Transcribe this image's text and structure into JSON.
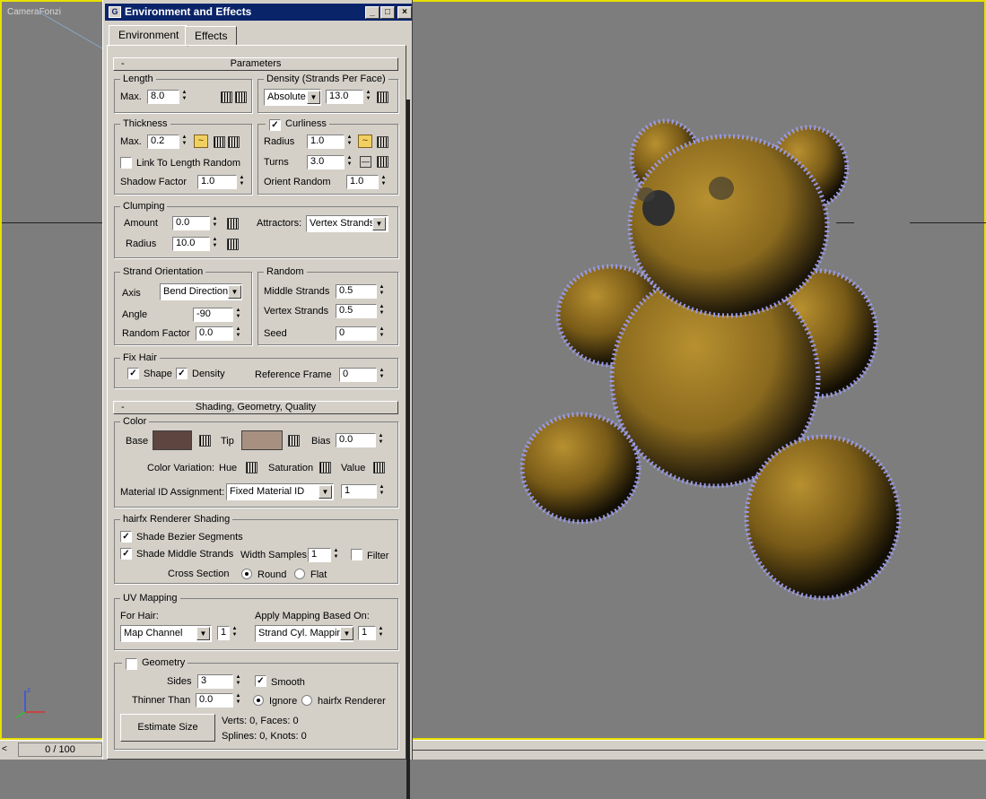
{
  "viewport": {
    "label": "CameraFonzi"
  },
  "timeline": {
    "counter": "0 / 100"
  },
  "dialog": {
    "title": "Environment and Effects",
    "tabs": [
      "Environment",
      "Effects"
    ],
    "parameters": {
      "header": "Parameters",
      "length": {
        "title": "Length",
        "max_label": "Max.",
        "max": "8.0"
      },
      "density": {
        "title": "Density (Strands Per Face)",
        "mode": "Absolute",
        "value": "13.0"
      },
      "thickness": {
        "title": "Thickness",
        "max_label": "Max.",
        "max": "0.2",
        "link_label": "Link To Length Random",
        "shadow_label": "Shadow Factor",
        "shadow": "1.0"
      },
      "curliness": {
        "title": "Curliness",
        "radius_label": "Radius",
        "radius": "1.0",
        "turns_label": "Turns",
        "turns": "3.0",
        "orient_label": "Orient Random",
        "orient": "1.0"
      },
      "clumping": {
        "title": "Clumping",
        "amount_label": "Amount",
        "amount": "0.0",
        "radius_label": "Radius",
        "radius": "10.0",
        "attractors_label": "Attractors:",
        "attractors": "Vertex Strands"
      },
      "orientation": {
        "title": "Strand Orientation",
        "axis_label": "Axis",
        "axis": "Bend Direction",
        "angle_label": "Angle",
        "angle": "-90",
        "random_label": "Random Factor",
        "random": "0.0"
      },
      "random": {
        "title": "Random",
        "middle_label": "Middle Strands",
        "middle": "0.5",
        "vertex_label": "Vertex Strands",
        "vertex": "0.5",
        "seed_label": "Seed",
        "seed": "0"
      },
      "fix_hair": {
        "title": "Fix Hair",
        "shape_label": "Shape",
        "density_label": "Density",
        "ref_label": "Reference Frame",
        "ref": "0"
      }
    },
    "shading": {
      "header": "Shading, Geometry, Quality",
      "color": {
        "title": "Color",
        "base_label": "Base",
        "base_color": "#5e4540",
        "tip_label": "Tip",
        "tip_color": "#a89080",
        "bias_label": "Bias",
        "bias": "0.0",
        "variation_label": "Color Variation:",
        "hue_label": "Hue",
        "sat_label": "Saturation",
        "value_label": "Value",
        "matid_label": "Material ID Assignment:",
        "matid_mode": "Fixed Material ID",
        "matid": "1"
      },
      "renderer": {
        "title": "hairfx Renderer Shading",
        "bezier_label": "Shade Bezier Segments",
        "middle_label": "Shade Middle Strands",
        "width_label": "Width Samples",
        "width": "1",
        "filter_label": "Filter",
        "cross_label": "Cross Section",
        "round_label": "Round",
        "flat_label": "Flat"
      },
      "uv": {
        "title": "UV Mapping",
        "for_hair_label": "For Hair:",
        "apply_label": "Apply Mapping Based On:",
        "channel_mode": "Map Channel",
        "channel": "1",
        "mapping": "Strand Cyl. Mappin",
        "mapping_val": "1"
      },
      "geometry": {
        "title": "Geometry",
        "sides_label": "Sides",
        "sides": "3",
        "smooth_label": "Smooth",
        "thinner_label": "Thinner Than",
        "thinner": "0.0",
        "ignore_label": "Ignore",
        "renderer_label": "hairfx Renderer",
        "estimate_label": "Estimate Size",
        "verts": "Verts: 0, Faces: 0",
        "splines": "Splines: 0, Knots: 0"
      }
    }
  },
  "colors": {
    "viewport_border": "#e8e000",
    "hair": "#9a9ae8",
    "fur": "#b08a28"
  }
}
